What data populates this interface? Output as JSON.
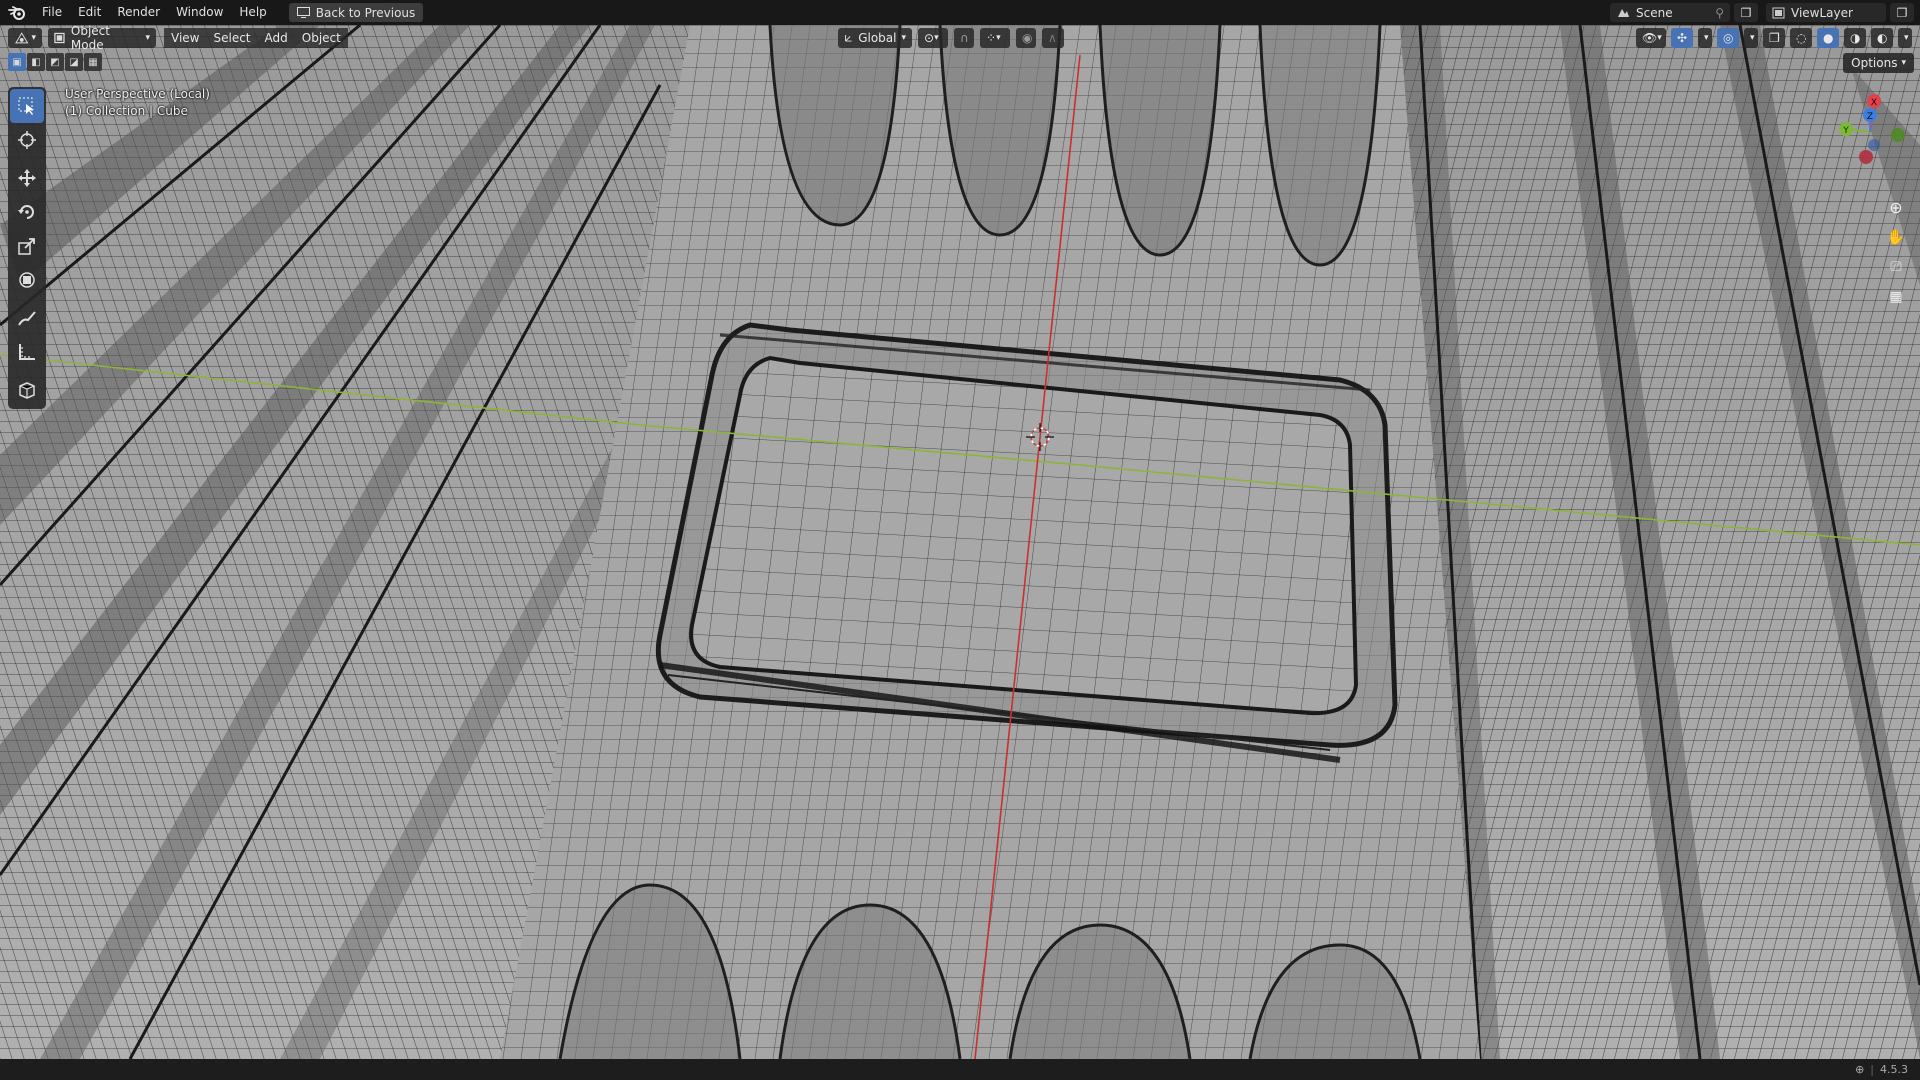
{
  "menubar": {
    "items": [
      "File",
      "Edit",
      "Render",
      "Window",
      "Help"
    ],
    "back_button": "Back to Previous",
    "scene": "Scene",
    "view_layer": "ViewLayer"
  },
  "viewport_header": {
    "mode": "Object Mode",
    "menus": [
      "View",
      "Select",
      "Add",
      "Object"
    ],
    "orientation": "Global",
    "options": "Options"
  },
  "overlay": {
    "line1": "User Perspective (Local)",
    "line2": "(1) Collection | Cube"
  },
  "gizmo": {
    "axes": [
      "X",
      "Y",
      "Z"
    ],
    "colors": {
      "x": "#e0424e",
      "y": "#7cb83a",
      "z": "#3d7fe0"
    }
  },
  "status": {
    "version": "4.5.3"
  },
  "colors": {
    "accent": "#4772b3",
    "mesh": "#a4a4a4",
    "wire": "#1a1a1a",
    "x_axis": "#c8312f",
    "y_axis": "#8fb33a"
  }
}
